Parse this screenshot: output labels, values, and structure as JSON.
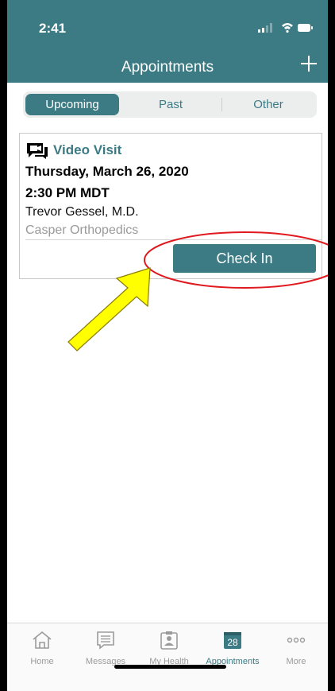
{
  "status": {
    "time": "2:41"
  },
  "header": {
    "title": "Appointments"
  },
  "segments": [
    {
      "label": "Upcoming",
      "active": true
    },
    {
      "label": "Past",
      "active": false
    },
    {
      "label": "Other",
      "active": false
    }
  ],
  "appointment": {
    "type_label": "Video Visit",
    "date": "Thursday, March 26, 2020",
    "time": "2:30 PM MDT",
    "provider": "Trevor Gessel, M.D.",
    "department": "Casper Orthopedics",
    "checkin_label": "Check In"
  },
  "tabs": [
    {
      "label": "Home",
      "icon": "home-icon"
    },
    {
      "label": "Messages",
      "icon": "messages-icon"
    },
    {
      "label": "My Health",
      "icon": "my-health-icon"
    },
    {
      "label": "Appointments",
      "icon": "calendar-icon",
      "badge": "28",
      "active": true
    },
    {
      "label": "More",
      "icon": "more-icon"
    }
  ],
  "colors": {
    "brand": "#3c7b84",
    "annotation_circle": "#e0191f",
    "annotation_arrow": "#ffff00"
  }
}
